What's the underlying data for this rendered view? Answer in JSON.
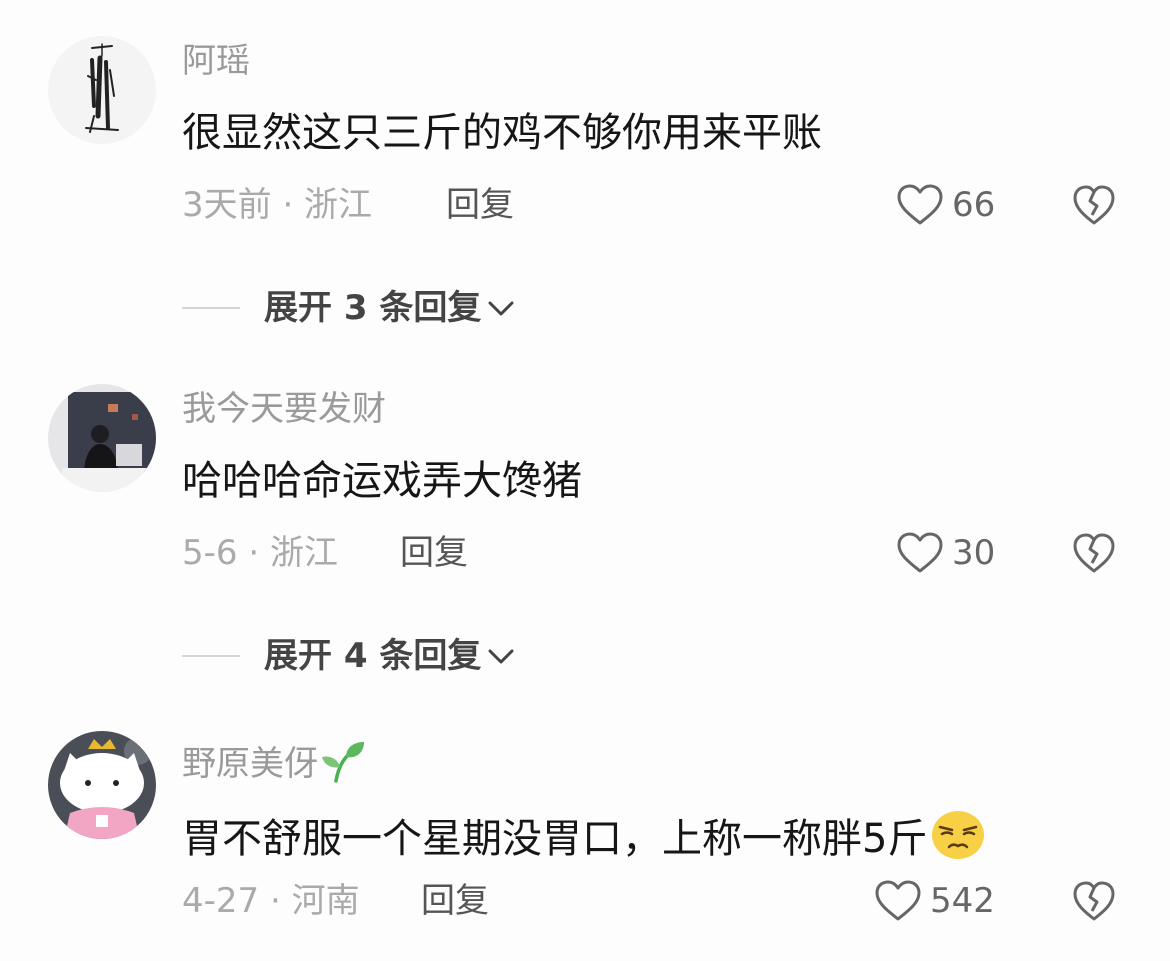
{
  "comments": [
    {
      "username": "阿瑶",
      "text": "很显然这只三斤的鸡不够你用来平账",
      "meta": "3天前 · 浙江",
      "reply_label": "回复",
      "likes": "66",
      "expand_label": "展开 3 条回复"
    },
    {
      "username": "我今天要发财",
      "text": "哈哈哈命运戏弄大馋猪",
      "meta": "5-6 · 浙江",
      "reply_label": "回复",
      "likes": "30",
      "expand_label": "展开 4 条回复"
    },
    {
      "username": "野原美伢",
      "username_badge_icon": "sprout-icon",
      "text": "胃不舒服一个星期没胃口，上称一称胖5斤",
      "text_emoji_icon": "smirk-emoji-icon",
      "meta": "4-27 · 河南",
      "reply_label": "回复",
      "likes": "542"
    }
  ],
  "icons": {
    "like": "heart-outline-icon",
    "dislike": "broken-heart-icon",
    "expand": "chevron-down-icon"
  },
  "colors": {
    "background": "#fdfdfd",
    "username": "#9a9a9a",
    "content": "#161616",
    "meta": "#aaaaaa"
  }
}
